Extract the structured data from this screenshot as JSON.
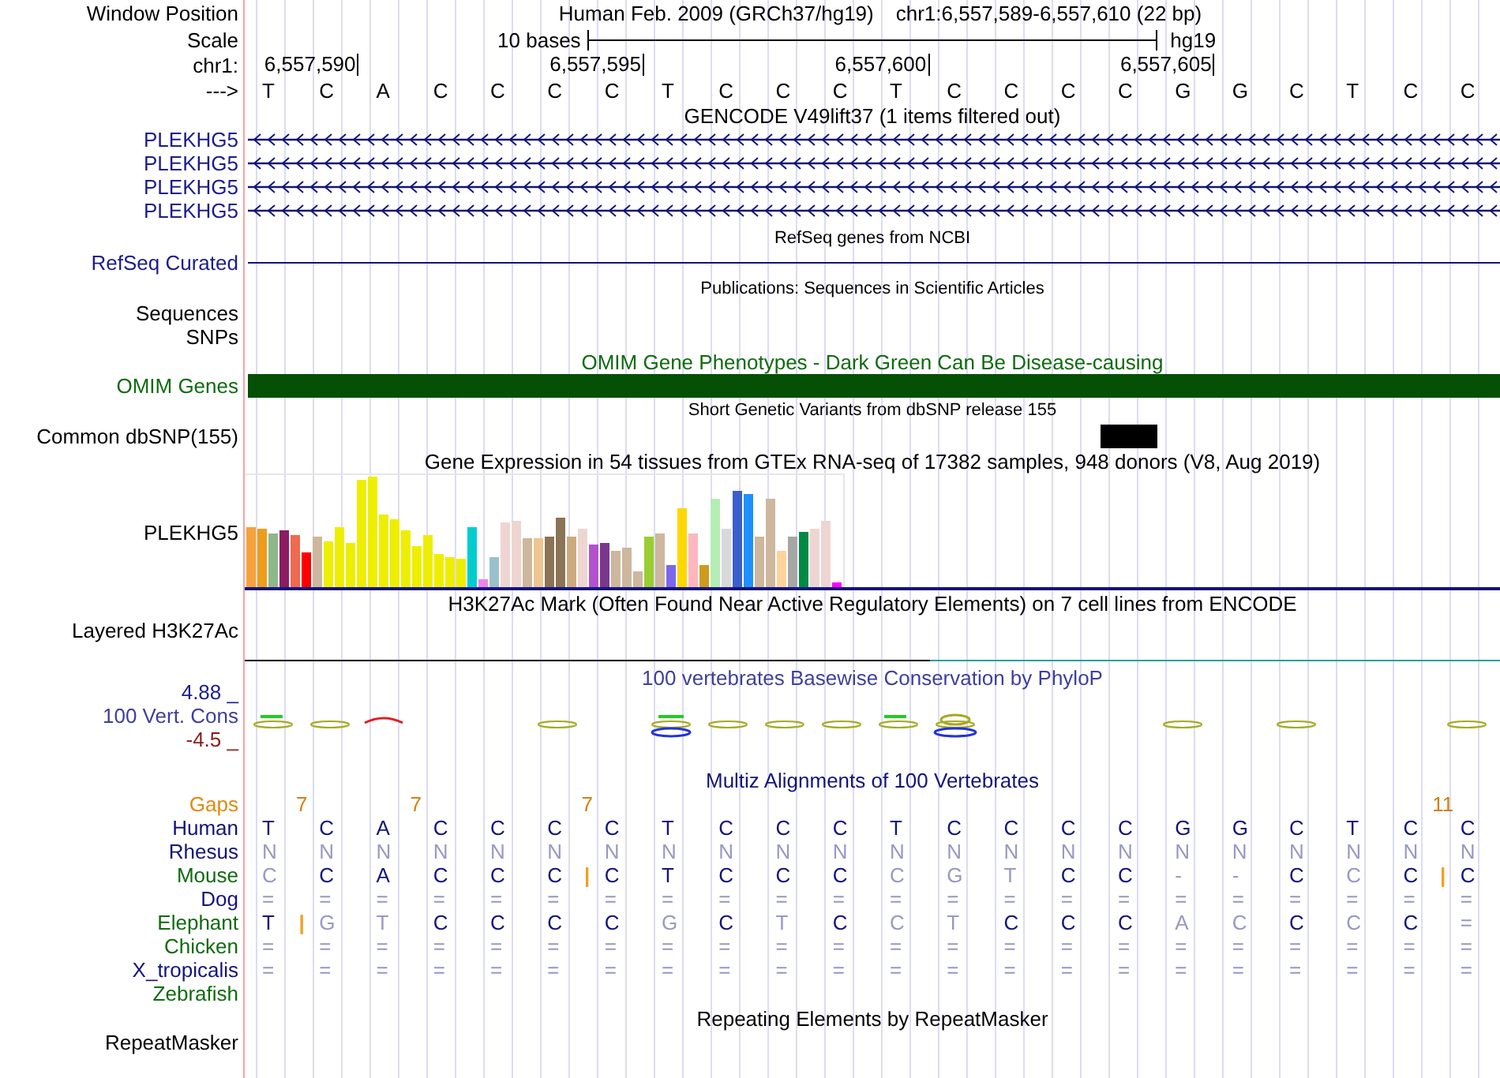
{
  "header": {
    "window_position_label": "Window Position",
    "assembly": "Human Feb. 2009 (GRCh37/hg19)",
    "position": "chr1:6,557,589-6,557,610 (22 bp)",
    "scale_label": "Scale",
    "scale_text": "10 bases",
    "scale_db": "hg19",
    "chrom_label": "chr1:",
    "positions": [
      "6,557,590",
      "6,557,595",
      "6,557,600",
      "6,557,605"
    ],
    "strand_label": "--->",
    "bases": [
      "T",
      "C",
      "A",
      "C",
      "C",
      "C",
      "C",
      "T",
      "C",
      "C",
      "C",
      "T",
      "C",
      "C",
      "C",
      "C",
      "G",
      "G",
      "C",
      "T",
      "C",
      "C"
    ]
  },
  "gencode": {
    "title": "GENCODE V49lift37 (1 items filtered out)",
    "genes": [
      "PLEKHG5",
      "PLEKHG5",
      "PLEKHG5",
      "PLEKHG5"
    ]
  },
  "refseq": {
    "title": "RefSeq genes from NCBI",
    "label": "RefSeq Curated"
  },
  "publications": {
    "title": "Publications: Sequences in Scientific Articles",
    "labels": [
      "Sequences",
      "SNPs"
    ]
  },
  "omim": {
    "title": "OMIM Gene Phenotypes - Dark Green Can Be Disease-causing",
    "label": "OMIM Genes"
  },
  "dbsnp": {
    "title": "Short Genetic Variants from dbSNP release 155",
    "label": "Common dbSNP(155)"
  },
  "gtex": {
    "title": "Gene Expression in 54 tissues from GTEx RNA-seq of 17382 samples, 948 donors (V8, Aug 2019)",
    "label": "PLEKHG5"
  },
  "h3k27ac": {
    "title": "H3K27Ac Mark (Often Found Near Active Regulatory Elements) on 7 cell lines from ENCODE",
    "label": "Layered H3K27Ac"
  },
  "conservation": {
    "title": "100 vertebrates Basewise Conservation by PhyloP",
    "label": "100 Vert. Cons",
    "max": "4.88 _",
    "min": "-4.5 _"
  },
  "multiz": {
    "title": "Multiz Alignments of 100 Vertebrates",
    "gaps_label": "Gaps",
    "gaps": [
      {
        "kind": "blank"
      },
      {
        "kind": "count",
        "label": "7"
      },
      {
        "kind": "blank"
      },
      {
        "kind": "count",
        "label": "7"
      },
      {
        "kind": "blank"
      },
      {
        "kind": "blank"
      },
      {
        "kind": "count",
        "label": "7"
      },
      {
        "kind": "blank"
      },
      {
        "kind": "blank"
      },
      {
        "kind": "blank"
      },
      {
        "kind": "blank"
      },
      {
        "kind": "blank"
      },
      {
        "kind": "blank"
      },
      {
        "kind": "blank"
      },
      {
        "kind": "blank"
      },
      {
        "kind": "blank"
      },
      {
        "kind": "blank"
      },
      {
        "kind": "blank"
      },
      {
        "kind": "blank"
      },
      {
        "kind": "blank"
      },
      {
        "kind": "blank"
      },
      {
        "kind": "count",
        "label": "11"
      }
    ],
    "species": [
      {
        "name": "Human",
        "color": "#14147a",
        "bases": [
          "T",
          "C",
          "A",
          "C",
          "C",
          "C",
          "C",
          "T",
          "C",
          "C",
          "C",
          "T",
          "C",
          "C",
          "C",
          "C",
          "G",
          "G",
          "C",
          "T",
          "C",
          "C"
        ]
      },
      {
        "name": "Rhesus",
        "color": "#14147a",
        "bases": [
          "N",
          "N",
          "N",
          "N",
          "N",
          "N",
          "N",
          "N",
          "N",
          "N",
          "N",
          "N",
          "N",
          "N",
          "N",
          "N",
          "N",
          "N",
          "N",
          "N",
          "N",
          "N"
        ]
      },
      {
        "name": "Mouse",
        "color": "#0f6b0f",
        "bases": [
          "C",
          "C",
          "A",
          "C",
          "C",
          "C",
          "|",
          "C",
          "T",
          "C",
          "C",
          "C",
          "C",
          "G",
          "T",
          "C",
          "C",
          "-",
          "-",
          "C",
          "C",
          "C",
          "|",
          "C"
        ]
      },
      {
        "name": "Dog",
        "color": "#14147a",
        "bases": [
          "=",
          "=",
          "=",
          "=",
          "=",
          "=",
          "=",
          "=",
          "=",
          "=",
          "=",
          "=",
          "=",
          "=",
          "=",
          "=",
          "=",
          "=",
          "=",
          "=",
          "=",
          "="
        ]
      },
      {
        "name": "Elephant",
        "color": "#0f6b0f",
        "bases": [
          "T",
          "|",
          "G",
          "T",
          "C",
          "C",
          "C",
          "C",
          "G",
          "C",
          "T",
          "C",
          "C",
          "T",
          "C",
          "C",
          "C",
          "A",
          "C",
          "C",
          "C",
          "C",
          "="
        ]
      },
      {
        "name": "Chicken",
        "color": "#0f6b0f",
        "bases": [
          "=",
          "=",
          "=",
          "=",
          "=",
          "=",
          "=",
          "=",
          "=",
          "=",
          "=",
          "=",
          "=",
          "=",
          "=",
          "=",
          "=",
          "=",
          "=",
          "=",
          "=",
          "="
        ]
      },
      {
        "name": "X_tropicalis",
        "color": "#14147a",
        "bases": [
          "=",
          "=",
          "=",
          "=",
          "=",
          "=",
          "=",
          "=",
          "=",
          "=",
          "=",
          "=",
          "=",
          "=",
          "=",
          "=",
          "=",
          "=",
          "=",
          "=",
          "=",
          "="
        ]
      },
      {
        "name": "Zebrafish",
        "color": "#0f6b0f"
      }
    ]
  },
  "repeatmasker": {
    "title": "Repeating Elements by RepeatMasker",
    "label": "RepeatMasker"
  }
}
